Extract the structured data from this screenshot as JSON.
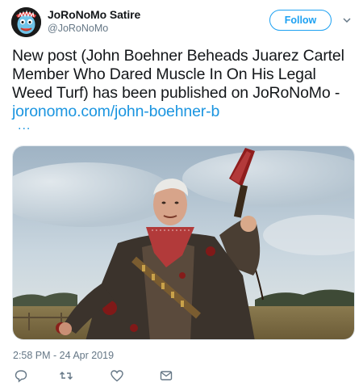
{
  "author": {
    "name": "JoRoNoMo Satire",
    "handle": "@JoRoNoMo",
    "avatar_icon": "cartoon-face-avatar"
  },
  "follow_label": "Follow",
  "tweet": {
    "text": "New post (John Boehner Beheads Juarez Cartel Member Who Dared Muscle In On His Legal Weed Turf) has been published on JoRoNoMo - ",
    "link": "joronomo.com/john-boehner-b",
    "ellipsis": "...",
    "timestamp": "2:58 PM - 24 Apr 2019"
  },
  "actions": [
    "reply-icon",
    "retweet-icon",
    "like-icon",
    "message-icon"
  ],
  "colors": {
    "brand": "#1da1f2",
    "link": "#1b95e0",
    "muted": "#657786",
    "text": "#14171a"
  }
}
